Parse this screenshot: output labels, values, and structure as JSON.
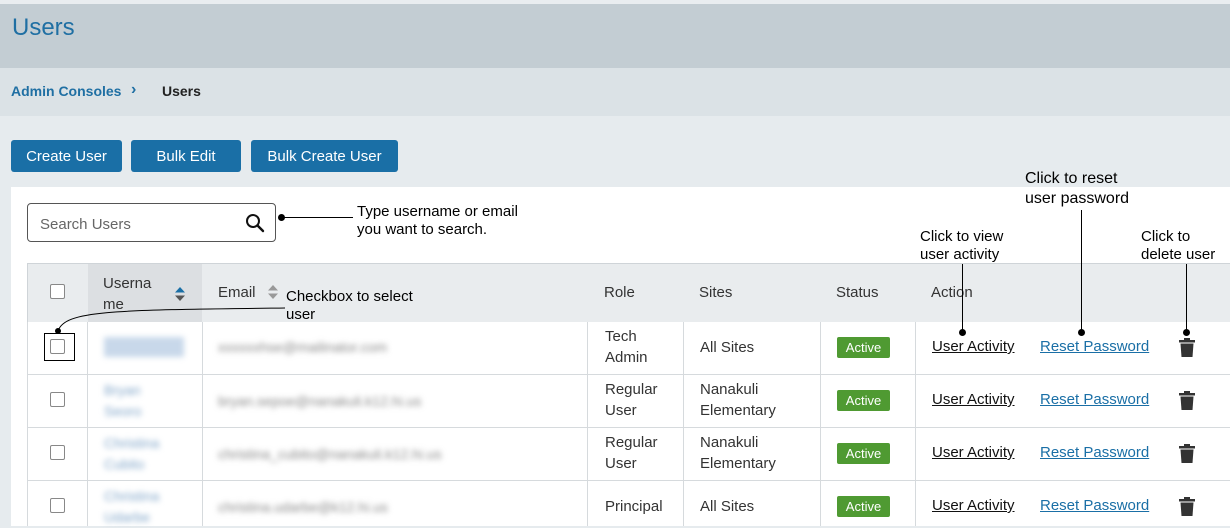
{
  "page": {
    "title": "Users"
  },
  "breadcrumb": {
    "parent": "Admin Consoles",
    "separator": "›",
    "current": "Users"
  },
  "toolbar": {
    "create_user": "Create User",
    "bulk_edit": "Bulk Edit",
    "bulk_create_user": "Bulk Create User"
  },
  "search": {
    "placeholder": "Search Users",
    "value": ""
  },
  "annotations": {
    "search_note": [
      "Type username or email",
      "you want to search."
    ],
    "checkbox_note": [
      "Checkbox to select",
      "user"
    ],
    "activity_note": [
      "Click to view",
      "user activity"
    ],
    "reset_note": [
      "Click to reset",
      "user password"
    ],
    "delete_note": [
      "Click to",
      "delete user"
    ]
  },
  "table": {
    "headers": {
      "username": "Userna me",
      "email": "Email",
      "role": "Role",
      "sites": "Sites",
      "status": "Status",
      "action": "Action"
    },
    "rows": [
      {
        "username": "xxxxxx",
        "email": "xxxxxxhse@mailinator.com",
        "role": "Tech Admin",
        "sites": "All Sites",
        "status": "Active",
        "activity": "User Activity",
        "reset": "Reset Password"
      },
      {
        "username": "Bryan Seoro",
        "email": "bryan.sepoe@nanakuli.k12.hi.us",
        "role": "Regular User",
        "sites": "Nanakuli Elementary",
        "status": "Active",
        "activity": "User Activity",
        "reset": "Reset Password"
      },
      {
        "username": "Christina Cubito",
        "email": "christina_cubito@nanakuli.k12.hi.us",
        "role": "Regular User",
        "sites": "Nanakuli Elementary",
        "status": "Active",
        "activity": "User Activity",
        "reset": "Reset Password"
      },
      {
        "username": "Christina Udarbe",
        "email": "christina.udarbe@k12.hi.us",
        "role": "Principal",
        "sites": "All Sites",
        "status": "Active",
        "activity": "User Activity",
        "reset": "Reset Password"
      }
    ]
  },
  "colors": {
    "accent": "#1a6fa6",
    "active_badge": "#4f9a32",
    "header_bg": "#c3cdd3"
  }
}
